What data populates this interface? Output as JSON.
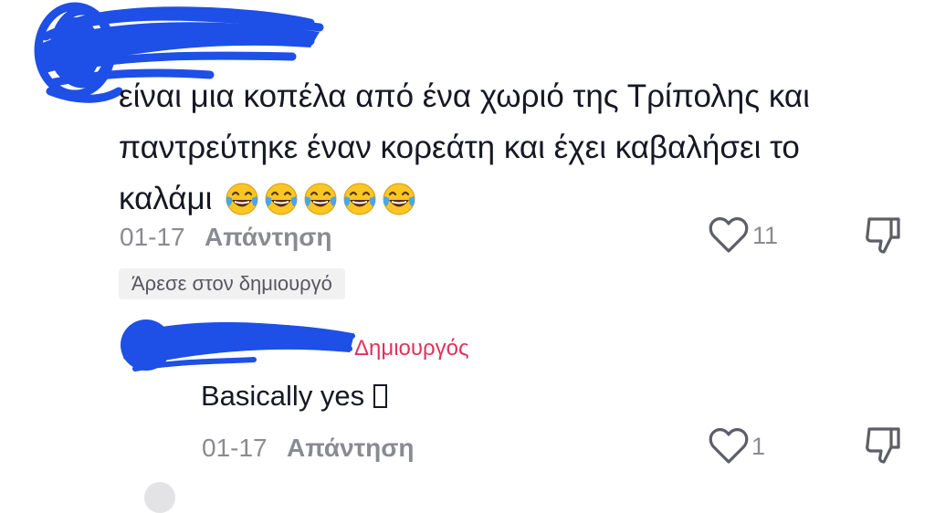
{
  "comment": {
    "text_line1": "είναι μια κοπέλα από ένα χωριό της Τρίπολης και",
    "text_line2": "παντρεύτηκε έναν κορεάτη και έχει καβαλήσει το",
    "text_line3": "καλάμι",
    "emojis": [
      "joy-emoji",
      "joy-emoji",
      "joy-emoji",
      "joy-emoji",
      "joy-emoji"
    ],
    "date": "01-17",
    "reply_label": "Απάντηση",
    "like_count": "11",
    "liked_by_creator_badge": "Άρεσε στον δημιουργό"
  },
  "reply": {
    "creator_label": "Δημιουργός",
    "text": "Basically yes",
    "date": "01-17",
    "reply_label": "Απάντηση",
    "like_count": "1"
  },
  "colors": {
    "scribble": "#1e4fe6",
    "creator": "#e0325d",
    "meta": "#8a8b91",
    "text": "#161823"
  },
  "icons": {
    "like": "heart-outline-icon",
    "dislike": "thumbs-down-outline-icon"
  }
}
